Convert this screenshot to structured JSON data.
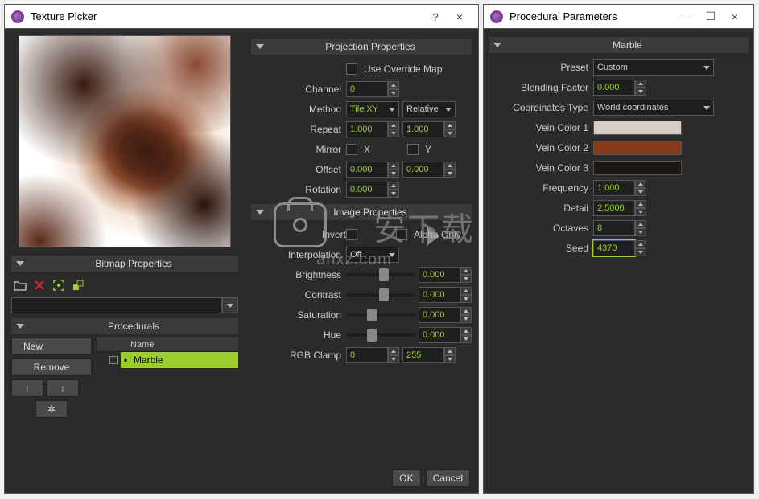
{
  "win1": {
    "title": "Texture Picker",
    "help": "?",
    "close": "×",
    "bitmap_section": "Bitmap Properties",
    "procedurals_section": "Procedurals",
    "tree_header": "Name",
    "tree_item": "Marble",
    "btn_new": "New",
    "btn_remove": "Remove",
    "btn_up": "↑",
    "btn_down": "↓",
    "btn_gear": "✲",
    "projection_section": "Projection Properties",
    "use_override": "Use Override Map",
    "lbl_channel": "Channel",
    "lbl_method": "Method",
    "lbl_repeat": "Repeat",
    "lbl_mirror": "Mirror",
    "lbl_offset": "Offset",
    "lbl_rotation": "Rotation",
    "val_channel": "0",
    "val_method1": "Tile XY",
    "val_method2": "Relative",
    "val_repeat1": "1.000",
    "val_repeat2": "1.000",
    "mirror_x": "X",
    "mirror_y": "Y",
    "val_offset1": "0.000",
    "val_offset2": "0.000",
    "val_rotation": "0.000",
    "image_section": "Image Properties",
    "chk_invert": "Invert",
    "chk_alpha": "Alpha Only",
    "lbl_interp": "Interpolation",
    "val_interp": "Off",
    "lbl_brightness": "Brightness",
    "val_brightness": "0.000",
    "lbl_contrast": "Contrast",
    "val_contrast": "0.000",
    "lbl_saturation": "Saturation",
    "val_saturation": "0.000",
    "lbl_hue": "Hue",
    "val_hue": "0.000",
    "lbl_rgbclamp": "RGB Clamp",
    "val_clamp_lo": "0",
    "val_clamp_hi": "255",
    "btn_ok": "OK",
    "btn_cancel": "Cancel"
  },
  "win2": {
    "title": "Procedural Parameters",
    "min": "—",
    "max": "☐",
    "close": "×",
    "section": "Marble",
    "lbl_preset": "Preset",
    "val_preset": "Custom",
    "lbl_blend": "Blending Factor",
    "val_blend": "0.000",
    "lbl_coords": "Coordinates Type",
    "val_coords": "World coordinates",
    "lbl_vc1": "Vein Color 1",
    "lbl_vc2": "Vein Color 2",
    "lbl_vc3": "Vein Color 3",
    "col_vc1": "#d6cec6",
    "col_vc2": "#8a3a1a",
    "col_vc3": "#1a1412",
    "lbl_freq": "Frequency",
    "val_freq": "1.000",
    "lbl_detail": "Detail",
    "val_detail": "2.5000",
    "lbl_oct": "Octaves",
    "val_oct": "8",
    "lbl_seed": "Seed",
    "val_seed": "4370"
  },
  "watermark": {
    "title": "安下载",
    "sub": "anxz.com"
  }
}
